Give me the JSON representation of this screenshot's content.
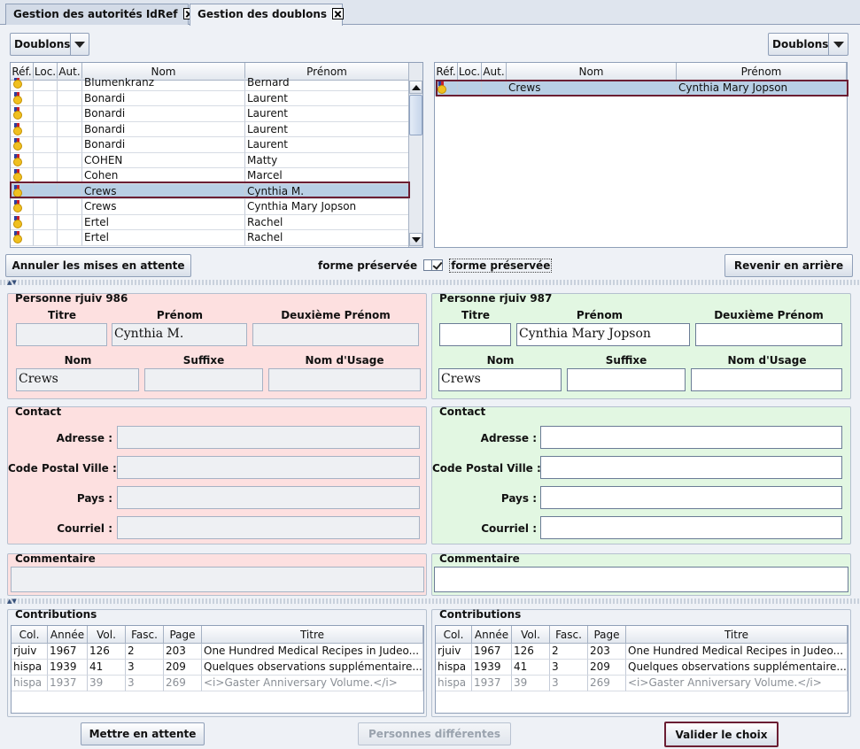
{
  "tabs": [
    {
      "label": "Gestion des autorités IdRef"
    },
    {
      "label": "Gestion des doublons"
    }
  ],
  "combo_left": "Doublons",
  "combo_right": "Doublons",
  "left_table": {
    "columns": [
      "Réf.",
      "Loc.",
      "Aut.",
      "Nom",
      "Prénom"
    ],
    "rows": [
      {
        "nom": "Blumenkranz",
        "prenom": "Bernard"
      },
      {
        "nom": "Bonardi",
        "prenom": "Laurent"
      },
      {
        "nom": "Bonardi",
        "prenom": "Laurent"
      },
      {
        "nom": "Bonardi",
        "prenom": "Laurent"
      },
      {
        "nom": "Bonardi",
        "prenom": "Laurent"
      },
      {
        "nom": "COHEN",
        "prenom": "Matty"
      },
      {
        "nom": "Cohen",
        "prenom": "Marcel"
      },
      {
        "nom": "Crews",
        "prenom": "Cynthia M."
      },
      {
        "nom": "Crews",
        "prenom": "Cynthia Mary Jopson"
      },
      {
        "nom": "Ertel",
        "prenom": "Rachel"
      },
      {
        "nom": "Ertel",
        "prenom": "Rachel"
      }
    ]
  },
  "right_table": {
    "columns": [
      "Réf.",
      "Loc.",
      "Aut.",
      "Nom",
      "Prénom"
    ],
    "rows": [
      {
        "nom": "Crews",
        "prenom": "Cynthia Mary Jopson"
      }
    ]
  },
  "mid_toolbar": {
    "annuler": "Annuler les mises en attente",
    "forme_left": "forme préservée",
    "forme_right": "forme préservée",
    "revenir": "Revenir en arrière"
  },
  "person_left": {
    "title": "Personne rjuiv 986",
    "titre_label": "Titre",
    "prenom_label": "Prénom",
    "deuxieme_label": "Deuxième Prénom",
    "nom_label": "Nom",
    "suffixe_label": "Suffixe",
    "usage_label": "Nom d'Usage",
    "titre": "",
    "prenom": "Cynthia M.",
    "deuxieme": "",
    "nom": "Crews",
    "suffixe": "",
    "usage": ""
  },
  "person_right": {
    "title": "Personne rjuiv 987",
    "titre_label": "Titre",
    "prenom_label": "Prénom",
    "deuxieme_label": "Deuxième Prénom",
    "nom_label": "Nom",
    "suffixe_label": "Suffixe",
    "usage_label": "Nom d'Usage",
    "titre": "",
    "prenom": "Cynthia Mary Jopson",
    "deuxieme": "",
    "nom": "Crews",
    "suffixe": "",
    "usage": ""
  },
  "contact": {
    "title": "Contact",
    "adresse": "Adresse :",
    "cp": "Code Postal Ville :",
    "pays": "Pays :",
    "courriel": "Courriel :"
  },
  "commentaire": "Commentaire",
  "contributions": {
    "title": "Contributions",
    "columns": [
      "Col.",
      "Année",
      "Vol.",
      "Fasc.",
      "Page",
      "Titre"
    ],
    "rows": [
      [
        "rjuiv",
        "1967",
        "126",
        "2",
        "203",
        "One Hundred Medical Recipes in Judeo..."
      ],
      [
        "hispa",
        "1939",
        "41",
        "3",
        "209",
        "Quelques observations supplémentaire..."
      ],
      [
        "hispa",
        "1937",
        "39",
        "3",
        "269",
        "<i>Gaster Anniversary Volume.</i>"
      ]
    ]
  },
  "bottom": {
    "mettre": "Mettre en attente",
    "differentes": "Personnes différentes",
    "valider": "Valider le choix"
  },
  "colors": {
    "selection": "#b8cfe5",
    "outline": "#6b1e33",
    "pink": "#fde0e0",
    "green": "#e2f7e2"
  }
}
